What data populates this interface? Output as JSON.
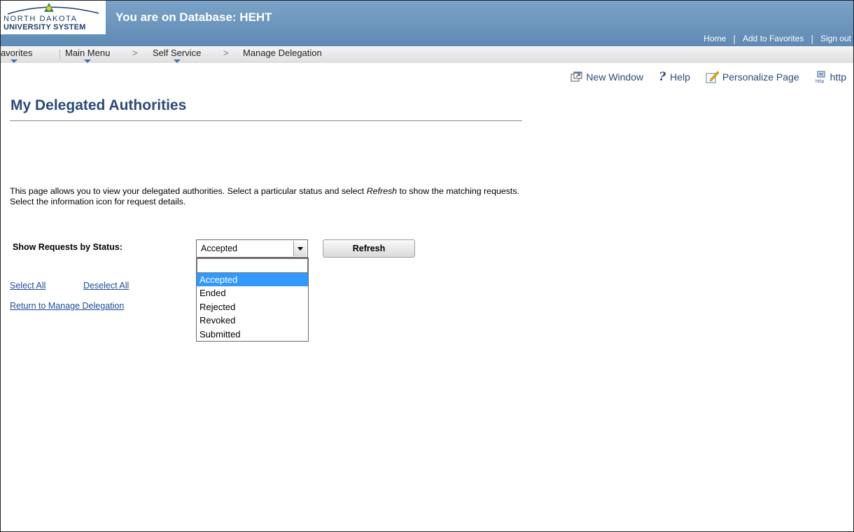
{
  "header": {
    "logo_line1": "NORTH DAKOTA",
    "logo_line2": "UNIVERSITY SYSTEM",
    "database_title": "You are on Database: HEHT",
    "links": [
      "Home",
      "Add to Favorites",
      "Sign out"
    ]
  },
  "nav": {
    "favorites": "Favorites",
    "main_menu": "Main Menu",
    "self_service": "Self Service",
    "manage_delegation": "Manage Delegation",
    "separator": ">"
  },
  "tools": {
    "new_window": "New Window",
    "help": "Help",
    "personalize": "Personalize Page",
    "http": "http"
  },
  "page": {
    "title": "My Delegated Authorities",
    "description_part1": "This page allows you to view your delegated authorities. Select a particular status and select ",
    "description_em": "Refresh",
    "description_part2": " to show the matching requests. Select the information icon for request details.",
    "status_label": "Show Requests by Status:",
    "status_value": "Accepted",
    "refresh_label": "Refresh",
    "status_options": [
      "",
      "Accepted",
      "Ended",
      "Rejected",
      "Revoked",
      "Submitted"
    ],
    "select_all": "Select All",
    "deselect_all": "Deselect All",
    "return_link": "Return to Manage Delegation"
  },
  "colors": {
    "header_blue": "#6a93bc",
    "title_blue": "#2a4a78",
    "link_blue": "#1f4b9a",
    "selected_option": "#3399ff"
  }
}
